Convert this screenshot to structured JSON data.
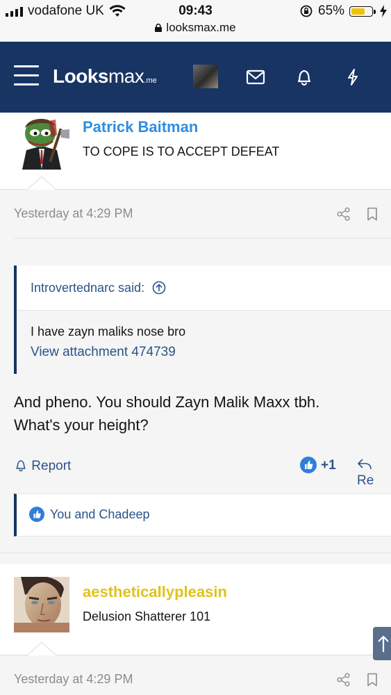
{
  "status_bar": {
    "carrier": "vodafone UK",
    "time": "09:43",
    "battery_percent": "65%",
    "battery_level": 0.65,
    "url": "looksmax.me"
  },
  "nav": {
    "logo_main": "Lo",
    "logo_oo": "o",
    "logo_ks": "ks",
    "logo_max": "max",
    "logo_suffix": ".me",
    "icons": [
      "menu-icon",
      "envelope-icon",
      "bell-icon",
      "bolt-icon"
    ]
  },
  "post1": {
    "username": "Patrick Baitman",
    "user_title": "TO COPE IS TO ACCEPT DEFEAT",
    "date": "Yesterday at 4:29 PM",
    "quote": {
      "author": "Introvertednarc said:",
      "text": "I have zayn maliks nose bro",
      "link": "View attachment 474739"
    },
    "body_line1": "And pheno. You should Zayn Malik Maxx tbh.",
    "body_line2": "What's your height?",
    "report_label": "Report",
    "like_count": "+1",
    "reply_label": "Re",
    "likes_text": "You and Chadeep"
  },
  "post2": {
    "username": "aestheticallypleasin",
    "user_title": "Delusion Shatterer 101",
    "date": "Yesterday at 4:29 PM"
  },
  "colors": {
    "nav_bg": "#173463",
    "link": "#2a5388",
    "username1": "#2f8ee0",
    "username2": "#e0c21c",
    "like_blue": "#2f7fd6"
  }
}
